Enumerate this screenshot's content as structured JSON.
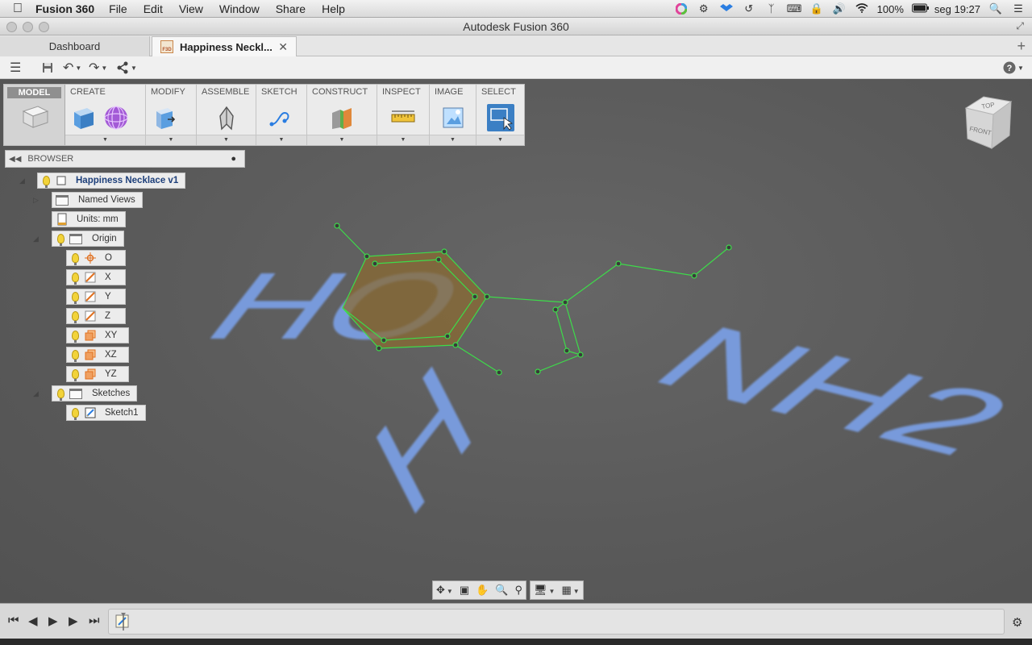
{
  "menubar": {
    "app_name": "Fusion 360",
    "menus": [
      "File",
      "Edit",
      "View",
      "Window",
      "Share",
      "Help"
    ],
    "battery": "100%",
    "clock": "seg 19:27"
  },
  "window": {
    "title": "Autodesk Fusion 360"
  },
  "tabs": {
    "dashboard": "Dashboard",
    "document": "Happiness Neckl...",
    "badge": "F3D"
  },
  "ribbon": {
    "workspace": "MODEL",
    "groups": [
      "CREATE",
      "MODIFY",
      "ASSEMBLE",
      "SKETCH",
      "CONSTRUCT",
      "INSPECT",
      "IMAGE",
      "SELECT"
    ]
  },
  "browser": {
    "title": "BROWSER",
    "root": "Happiness Necklace v1",
    "named_views": "Named Views",
    "units": "Units: mm",
    "origin": "Origin",
    "origin_items": [
      "O",
      "X",
      "Y",
      "Z",
      "XY",
      "XZ",
      "YZ"
    ],
    "sketches": "Sketches",
    "sketch1": "Sketch1"
  },
  "viewcube": {
    "top": "TOP",
    "front": "FRONT"
  },
  "scene": {
    "letters_left": "HO",
    "letters_right": "NH2",
    "letter_bottom": "H"
  },
  "colors": {
    "viewport": "#5a5a5a",
    "text_extrude": "#7b9fe6",
    "sketch_line": "#3ddc4a",
    "profile_fill": "#8a6a32",
    "select_blue": "#3b7fc4"
  }
}
